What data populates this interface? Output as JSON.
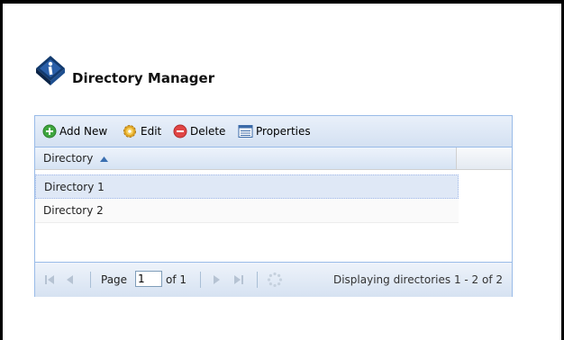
{
  "app": {
    "title": "Directory Manager",
    "logo_icon": "info-book-icon"
  },
  "toolbar": {
    "add_label": "Add New",
    "edit_label": "Edit",
    "delete_label": "Delete",
    "properties_label": "Properties"
  },
  "grid": {
    "column_header": "Directory",
    "sort": "ascending",
    "rows": [
      {
        "label": "Directory 1",
        "selected": true
      },
      {
        "label": "Directory 2",
        "selected": false
      }
    ]
  },
  "paging": {
    "page_label": "Page",
    "page_value": "1",
    "of_label": "of 1",
    "display_text": "Displaying directories 1 - 2 of 2"
  },
  "colors": {
    "panel_border": "#99bbe8",
    "selected_row": "#dfe8f6",
    "add_green": "#3fa63f",
    "delete_red": "#e04545"
  }
}
